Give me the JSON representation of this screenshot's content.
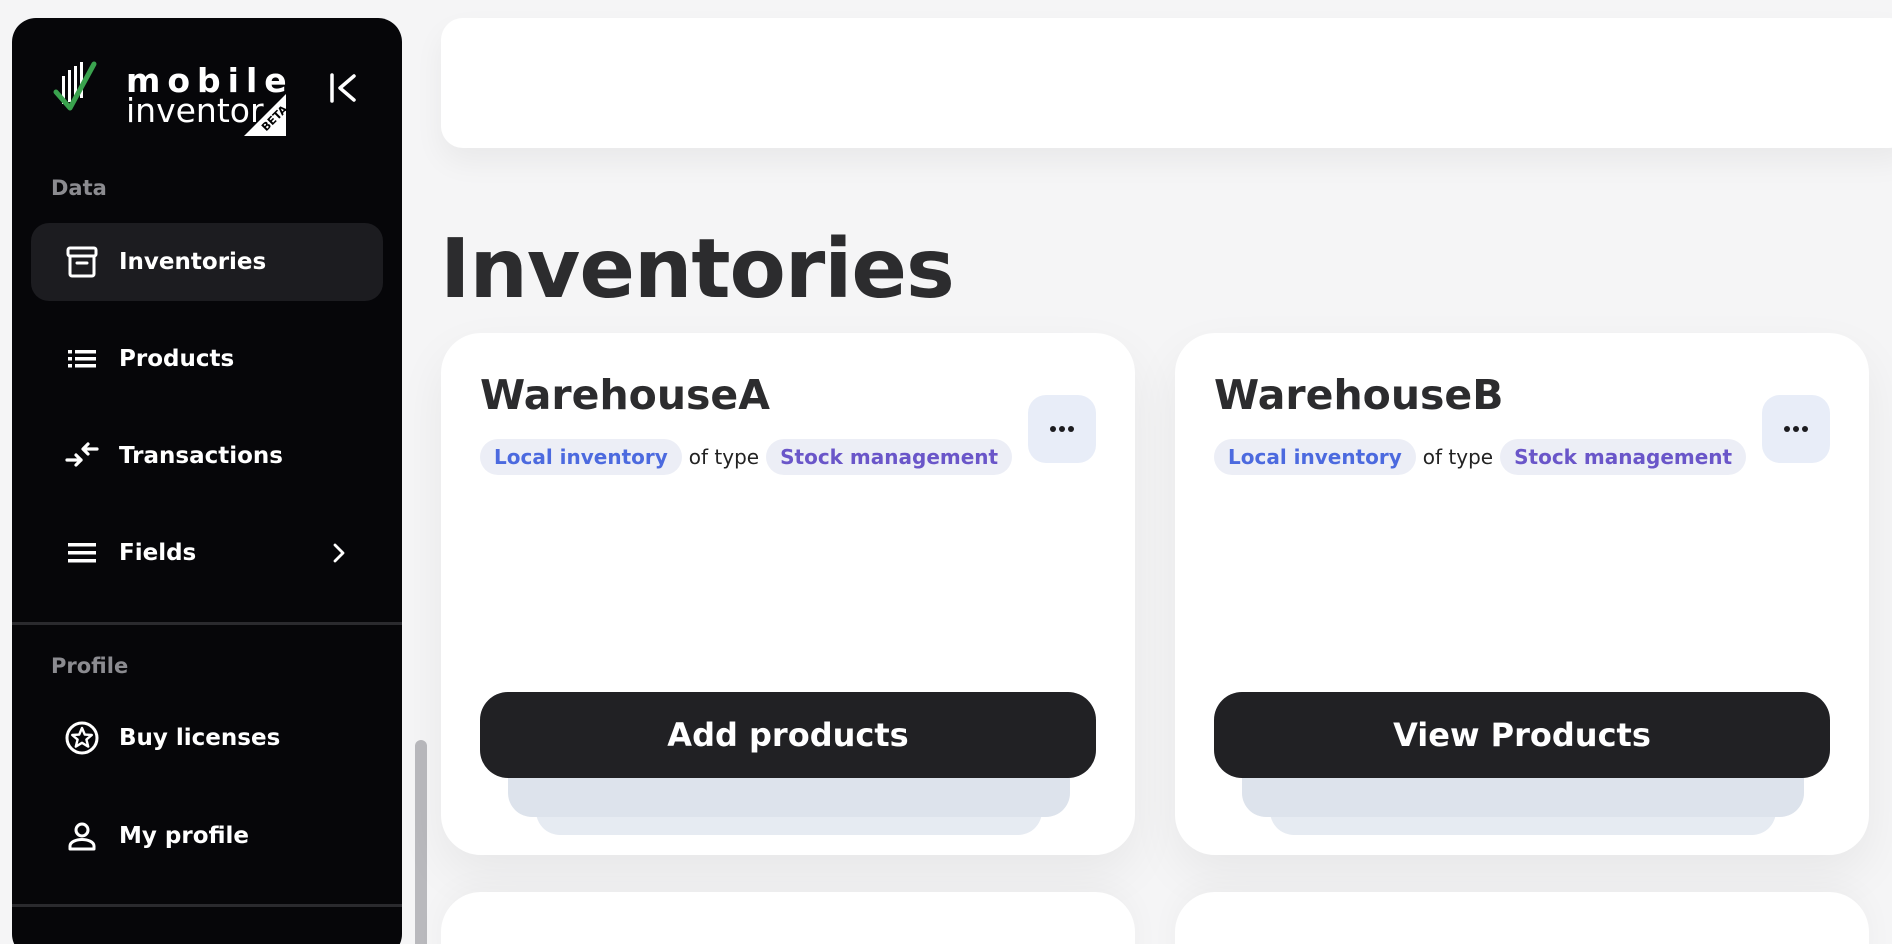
{
  "brand": {
    "line1": "mobile",
    "line2": "inventor",
    "badge": "BETA"
  },
  "sidebar": {
    "sections": {
      "data": "Data",
      "profile": "Profile"
    },
    "items": [
      {
        "label": "Inventories",
        "icon": "archive-icon",
        "active": true
      },
      {
        "label": "Products",
        "icon": "list-icon",
        "active": false
      },
      {
        "label": "Transactions",
        "icon": "transactions-arrows-icon",
        "active": false
      },
      {
        "label": "Fields",
        "icon": "menu-lines-icon",
        "active": false,
        "has_submenu": true
      },
      {
        "label": "Buy licenses",
        "icon": "star-badge-icon",
        "active": false
      },
      {
        "label": "My profile",
        "icon": "person-icon",
        "active": false
      }
    ]
  },
  "main": {
    "title": "Inventories",
    "cards": [
      {
        "name": "WarehouseA",
        "location_chip": "Local inventory",
        "of_type": "of type",
        "type_chip": "Stock management",
        "action": "Add products"
      },
      {
        "name": "WarehouseB",
        "location_chip": "Local inventory",
        "of_type": "of type",
        "type_chip": "Stock management",
        "action": "View Products"
      }
    ]
  },
  "colors": {
    "sidebar_bg": "#060609",
    "active_item_bg": "#1c1c20",
    "chip_bg": "#eceef6",
    "chip_blue": "#4c6adf",
    "chip_purple": "#6a56c9",
    "button_dark": "#212124",
    "logo_green": "#3aa24e"
  }
}
